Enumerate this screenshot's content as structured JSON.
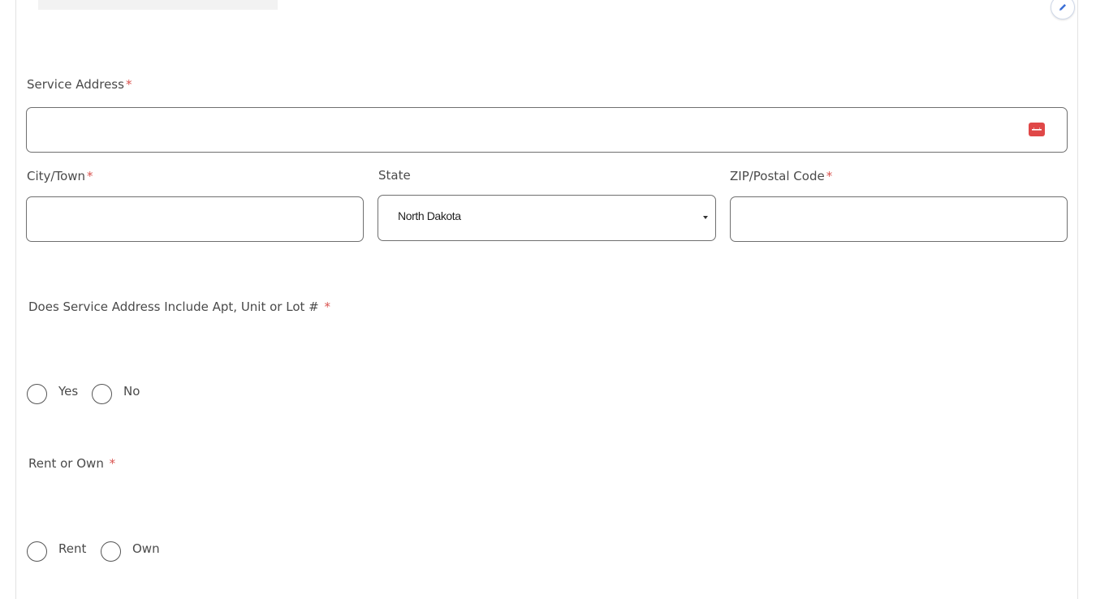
{
  "form": {
    "service_address": {
      "label": "Service Address",
      "required_mark": "*",
      "value": "",
      "icon": "address-card-icon"
    },
    "city": {
      "label": "City/Town",
      "required_mark": "*",
      "value": ""
    },
    "state": {
      "label": "State",
      "selected": "North Dakota"
    },
    "zip": {
      "label": "ZIP/Postal Code",
      "required_mark": "*",
      "value": ""
    },
    "apt_question": {
      "label": "Does Service Address Include Apt, Unit or Lot #",
      "required_mark": "*",
      "options": [
        "Yes",
        "No"
      ]
    },
    "rent_own": {
      "label": "Rent or Own",
      "required_mark": "*",
      "options": [
        "Rent",
        "Own"
      ]
    }
  },
  "colors": {
    "required": "#d9534f",
    "address_icon": "#e04848",
    "edit_icon": "#3b6fd6"
  },
  "icons": {
    "edit": "pencil-icon"
  }
}
